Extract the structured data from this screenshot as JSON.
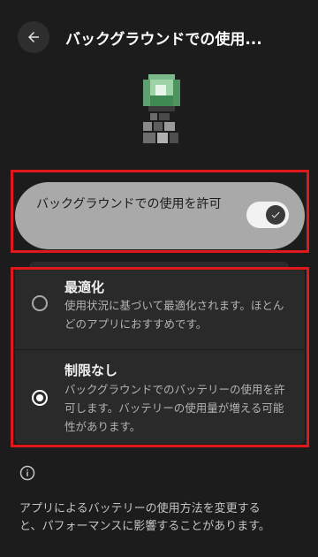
{
  "header": {
    "title": "バックグラウンドでの使用...",
    "back_icon": "arrow-left-icon"
  },
  "app": {
    "icon": "blurred-app-icon"
  },
  "toggle": {
    "label": "バックグラウンドでの使用を許可",
    "state": "on"
  },
  "options": [
    {
      "title": "最適化",
      "description": "使用状況に基づいて最適化されます。ほとんどのアプリにおすすめです。",
      "selected": false
    },
    {
      "title": "制限なし",
      "description": "バックグラウンドでのバッテリーの使用を許可します。バッテリーの使用量が増える可能性があります。",
      "selected": true
    }
  ],
  "footer": {
    "info_icon": "info-icon",
    "text": "アプリによるバッテリーの使用方法を変更すると、パフォーマンスに影響することがあります。"
  },
  "colors": {
    "highlight": "#e0181c",
    "background": "#1c1c1c",
    "toggle_card": "#a9a9a9"
  }
}
